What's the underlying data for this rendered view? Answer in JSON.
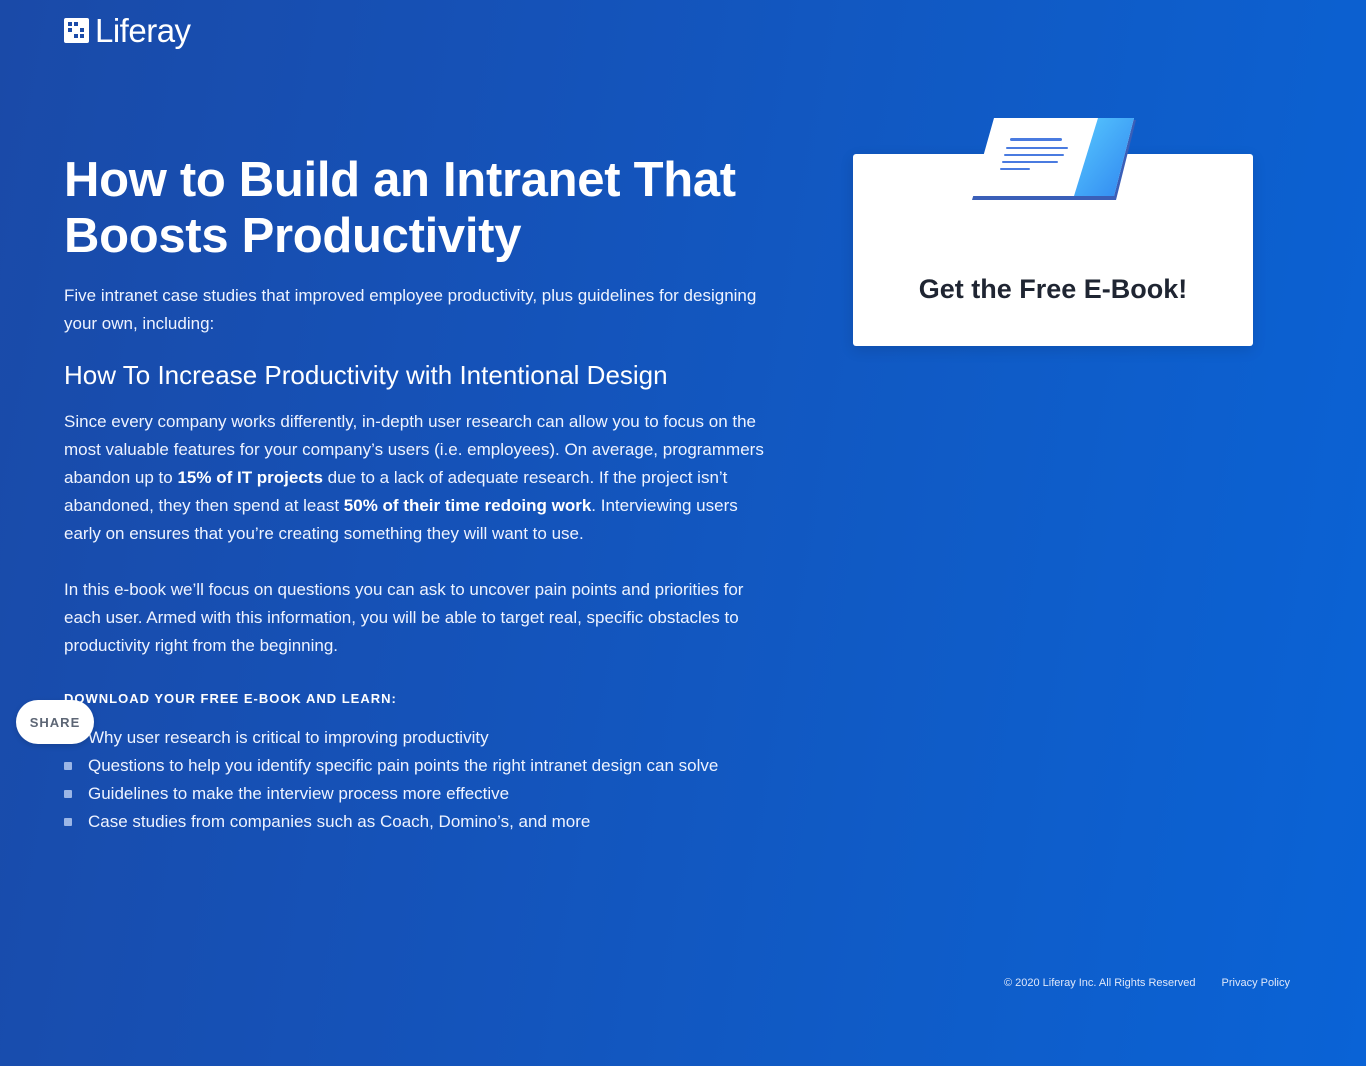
{
  "brand": {
    "name": "Liferay"
  },
  "hero": {
    "title": "How to Build an Intranet That Boosts Productivity",
    "intro": "Five intranet case studies that improved employee productivity, plus guidelines for designing your own, including:",
    "subtitle": "How To Increase Productivity with Intentional Design",
    "para1": {
      "part1": "Since every company works differently, in-depth user research can allow you to focus on the most valuable features for your company’s users (i.e. employees). On average, programmers abandon up to ",
      "strong1": "15% of IT projects",
      "part2": " due to a lack of adequate research. If the project isn’t abandoned, they then spend at least ",
      "strong2": "50% of their time redoing work",
      "part3": ". Interviewing users early on ensures that you’re creating something they will want to use."
    },
    "para2": "In this e-book we’ll focus on questions you can ask to uncover pain points and priorities for each user. Armed with this information, you will be able to target real, specific obstacles to productivity right from the beginning.",
    "learn_heading": "DOWNLOAD YOUR FREE E-BOOK AND LEARN:",
    "bullets": [
      "Why user research is critical to improving productivity",
      "Questions to help you identify specific pain points the right intranet design can solve",
      "Guidelines to make the interview process more effective",
      "Case studies from companies such as Coach, Domino’s, and more"
    ]
  },
  "share": {
    "label": "SHARE"
  },
  "card": {
    "title": "Get the Free E-Book!"
  },
  "footer": {
    "copyright": "© 2020 Liferay Inc. All Rights Reserved",
    "privacy": "Privacy Policy"
  },
  "icons": {
    "logo": "liferay-logo-icon",
    "ebook": "ebook-illustration-icon"
  },
  "colors": {
    "background_start": "#1a4aa8",
    "background_end": "#0a63d6",
    "card_text": "#1f2532",
    "share_text": "#5d6675"
  }
}
